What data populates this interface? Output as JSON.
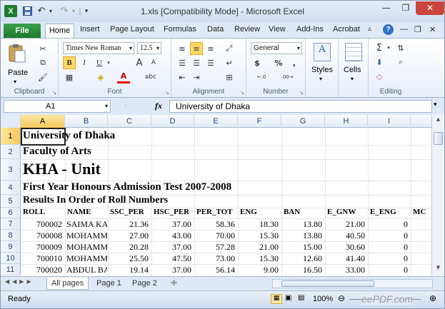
{
  "window": {
    "title": "1.xls  [Compatibility Mode]  -  Microsoft Excel"
  },
  "quick_access": {
    "undo": "↶",
    "redo": "↷",
    "separator": "|"
  },
  "ribbon_tabs": [
    "File",
    "Home",
    "Insert",
    "Page Layout",
    "Formulas",
    "Data",
    "Review",
    "View",
    "Add-Ins",
    "Acrobat"
  ],
  "ribbon": {
    "clipboard": {
      "label": "Clipboard",
      "paste": "Paste"
    },
    "font": {
      "label": "Font",
      "name": "Times New Roman",
      "size": "12.5",
      "bold": "B",
      "italic": "I",
      "underline": "U",
      "grow": "A",
      "shrink": "A",
      "color_a": "A"
    },
    "alignment": {
      "label": "Alignment"
    },
    "number": {
      "label": "Number",
      "format": "General",
      "currency": "$",
      "percent": "%",
      "comma": ",",
      "inc": "←.0",
      "dec": ".00→"
    },
    "styles": {
      "label": "Styles"
    },
    "cells": {
      "label": "Cells"
    },
    "editing": {
      "label": "Editing",
      "sum": "Σ"
    }
  },
  "formula_bar": {
    "name_box": "A1",
    "fx": "fx",
    "content": "University of Dhaka"
  },
  "columns": [
    "A",
    "B",
    "C",
    "D",
    "E",
    "F",
    "G",
    "H",
    "I"
  ],
  "rows": [
    {
      "num": "1",
      "text": "University of Dhaka"
    },
    {
      "num": "2",
      "text": "Faculty of Arts"
    },
    {
      "num": "3",
      "text": "KHA - Unit"
    },
    {
      "num": "4",
      "text": "First Year Honours Admission Test 2007-2008"
    },
    {
      "num": "5",
      "text": "Results In Order of Roll Numbers"
    }
  ],
  "table_header": {
    "num": "6",
    "cells": [
      "ROLL",
      "NAME",
      "SSC_PER",
      "HSC_PER",
      "PER_TOT",
      "ENG",
      "BAN",
      "E_GNW",
      "E_ENG",
      "MC"
    ]
  },
  "table_rows": [
    {
      "num": "7",
      "cells": [
        "700002",
        "SAIMA KA",
        "21.36",
        "37.00",
        "58.36",
        "18.30",
        "13.80",
        "21.00",
        "0"
      ]
    },
    {
      "num": "8",
      "cells": [
        "700008",
        "MOHAMM",
        "27.00",
        "43.00",
        "70.00",
        "15.30",
        "13.80",
        "40.50",
        "0"
      ]
    },
    {
      "num": "9",
      "cells": [
        "700009",
        "MOHAMM",
        "20.28",
        "37.00",
        "57.28",
        "21.00",
        "15.00",
        "30.60",
        "0"
      ]
    },
    {
      "num": "10",
      "cells": [
        "700010",
        "MOHAMM",
        "25.50",
        "47.50",
        "73.00",
        "15.30",
        "12.60",
        "41.40",
        "0"
      ]
    },
    {
      "num": "11",
      "cells": [
        "700020",
        "ABDUL BA",
        "19.14",
        "37.00",
        "56.14",
        "9.00",
        "16.50",
        "33.00",
        "0"
      ]
    }
  ],
  "sheet_tabs": [
    "All pages",
    "Page 1",
    "Page 2"
  ],
  "status": {
    "ready": "Ready",
    "zoom": "100%",
    "watermark": "eePDF.com"
  }
}
